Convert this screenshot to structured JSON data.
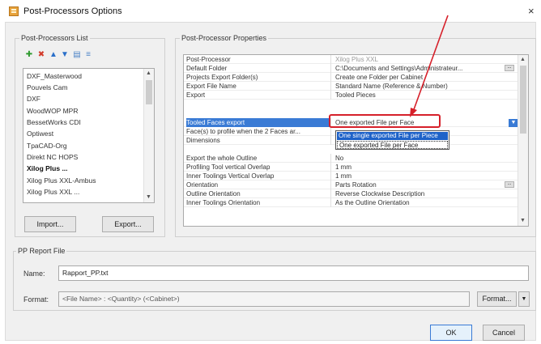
{
  "window": {
    "title": "Post-Processors Options",
    "close_glyph": "×"
  },
  "left_group": {
    "label": "Post-Processors List",
    "toolbar_glyphs": [
      "✚",
      "✖",
      "▲",
      "▼",
      "▤",
      "≡"
    ],
    "items": [
      "DXF_Masterwood",
      "Pouvels Cam",
      "DXF",
      "WoodWOP MPR",
      "BessetWorks CDI",
      "Optiwest",
      "TpaCAD-Org",
      "Direkt NC HOPS",
      "Xilog Plus ...",
      "Xilog Plus XXL-Ambus",
      "Xilog Plus XXL ..."
    ],
    "selected_index": 8,
    "import_label": "Import...",
    "export_label": "Export..."
  },
  "props_group": {
    "label": "Post-Processor Properties",
    "rows": [
      {
        "name": "Post-Processor",
        "value": "Xilog Plus XXL"
      },
      {
        "name": "Default Folder",
        "value": "C:\\Documents and Settings\\Administrateur..."
      },
      {
        "name": "Projects Export Folder(s)",
        "value": "Create one Folder per Cabinet"
      },
      {
        "name": "Export File Name",
        "value": "Standard Name (Reference & Number)"
      },
      {
        "name": "Export",
        "value": "Tooled Pieces"
      },
      {
        "name": "Tooled Faces export",
        "value": "One exported File per Face"
      },
      {
        "name": "Face(s) to profile when the 2 Faces ar...",
        "value": ""
      },
      {
        "name": "Dimensions",
        "value": ""
      },
      {
        "name": "Export the whole Outline",
        "value": "No"
      },
      {
        "name": "Profiling Tool vertical Overlap",
        "value": "1 mm"
      },
      {
        "name": "Inner Toolings Vertical Overlap",
        "value": "1 mm"
      },
      {
        "name": "Orientation",
        "value": "Parts Rotation"
      },
      {
        "name": "Outline Orientation",
        "value": "Reverse Clockwise Description"
      },
      {
        "name": "Inner Toolings Orientation",
        "value": "As the Outline Orientation"
      }
    ],
    "ellipsis_glyph": "...",
    "dropdown_arrow_glyph": "▼",
    "dropdown_options": [
      "One single exported File per Piece",
      "One exported File per Face"
    ]
  },
  "report_group": {
    "label": "PP Report File",
    "name_label": "Name:",
    "name_value": "Rapport_PP.txt",
    "format_label": "Format:",
    "format_value": "<File Name> : <Quantity> (<Cabinet>)",
    "format_button": "Format...",
    "format_arrow": "▼"
  },
  "buttons": {
    "ok": "OK",
    "cancel": "Cancel"
  },
  "colors": {
    "annotation": "#d6202a",
    "selection": "#3a7bd5"
  }
}
